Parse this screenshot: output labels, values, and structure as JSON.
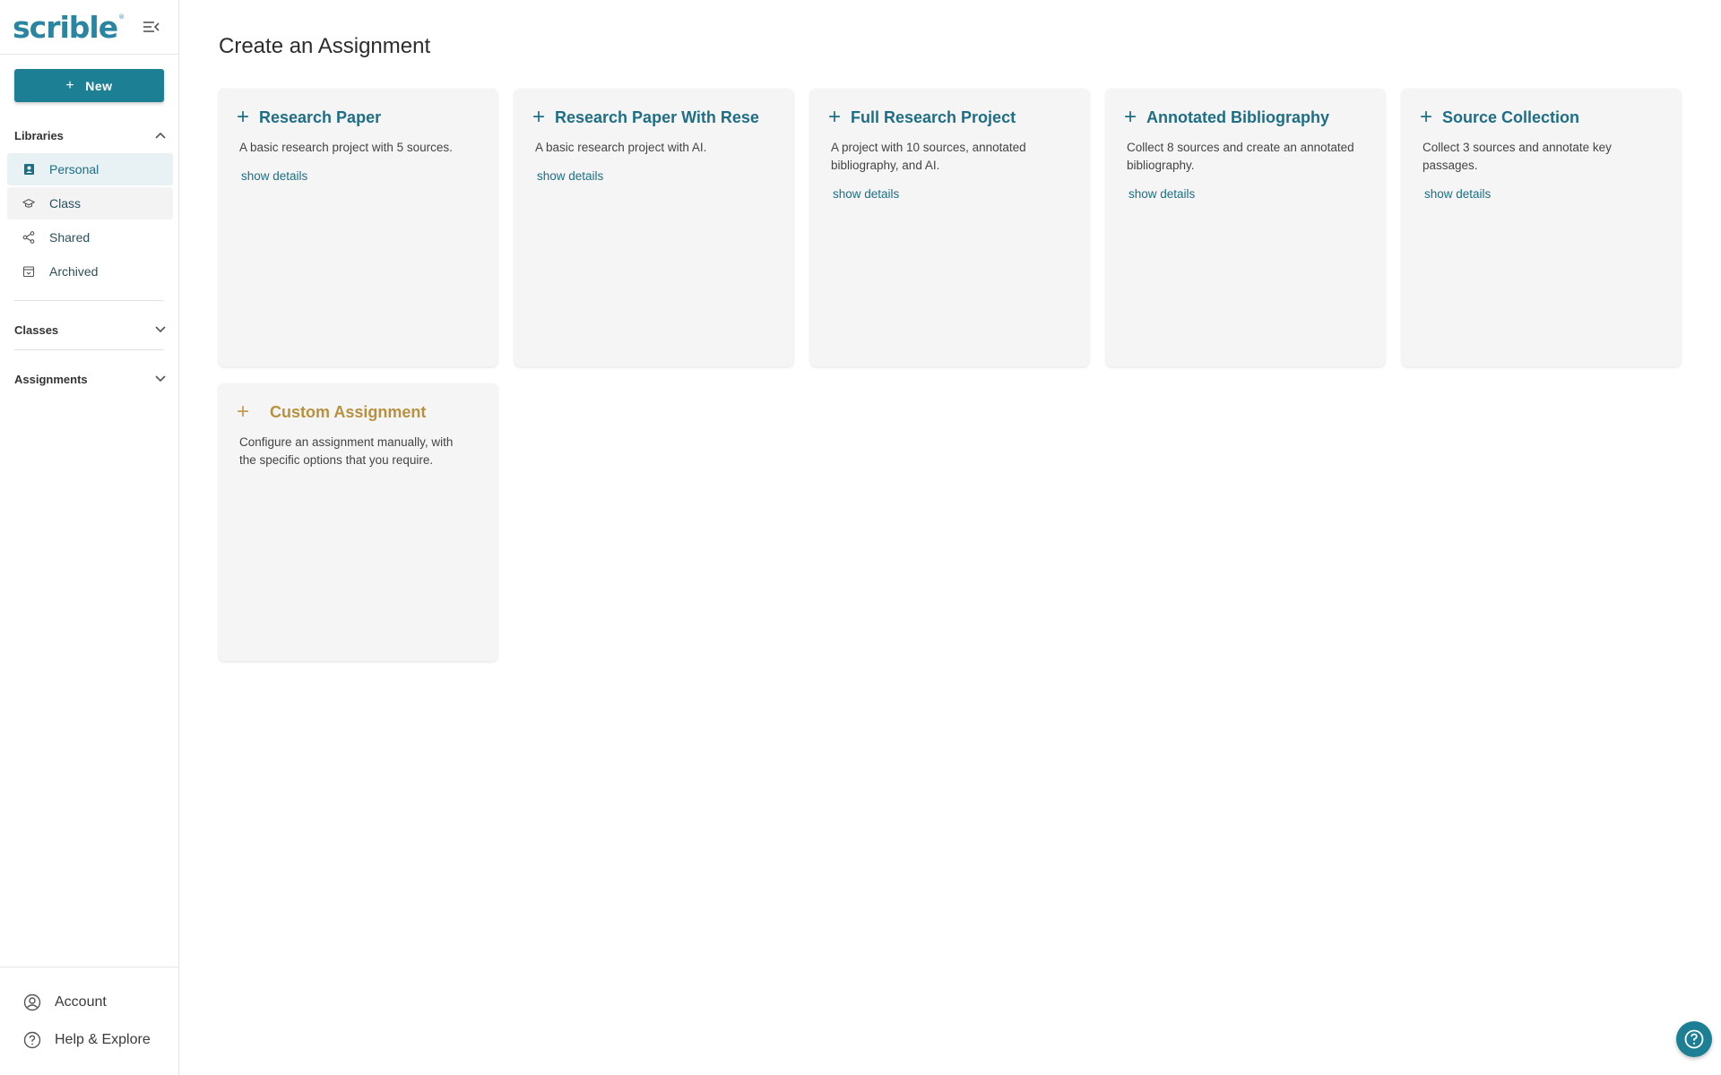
{
  "sidebar": {
    "logo_text": "scrible",
    "logo_mark": "®",
    "new_label": "New",
    "libraries_label": "Libraries",
    "nav": [
      {
        "label": "Personal",
        "icon": "contact-book-icon"
      },
      {
        "label": "Class",
        "icon": "graduation-cap-icon"
      },
      {
        "label": "Shared",
        "icon": "share-icon"
      },
      {
        "label": "Archived",
        "icon": "archive-icon"
      }
    ],
    "classes_label": "Classes",
    "assignments_label": "Assignments",
    "account_label": "Account",
    "help_label": "Help & Explore"
  },
  "main": {
    "title": "Create an Assignment",
    "cards": [
      {
        "title": "Research Paper",
        "desc": "A basic research project with 5 sources.",
        "link": "show details"
      },
      {
        "title": "Research Paper With Rese",
        "desc": "A basic research project with AI.",
        "link": "show details"
      },
      {
        "title": "Full Research Project",
        "desc": "A project with 10 sources, annotated bibliography, and AI.",
        "link": "show details"
      },
      {
        "title": "Annotated Bibliography",
        "desc": "Collect 8 sources and create an annotated bibliography.",
        "link": "show details"
      },
      {
        "title": "Source Collection",
        "desc": "Collect 3 sources and annotate key passages.",
        "link": "show details"
      },
      {
        "title": "Custom Assignment",
        "desc": "Configure an assignment manually, with the specific options that you require."
      }
    ]
  },
  "colors": {
    "accent": "#1c7f94",
    "title_teal": "#1f6e85",
    "custom_gold": "#b8913f"
  }
}
